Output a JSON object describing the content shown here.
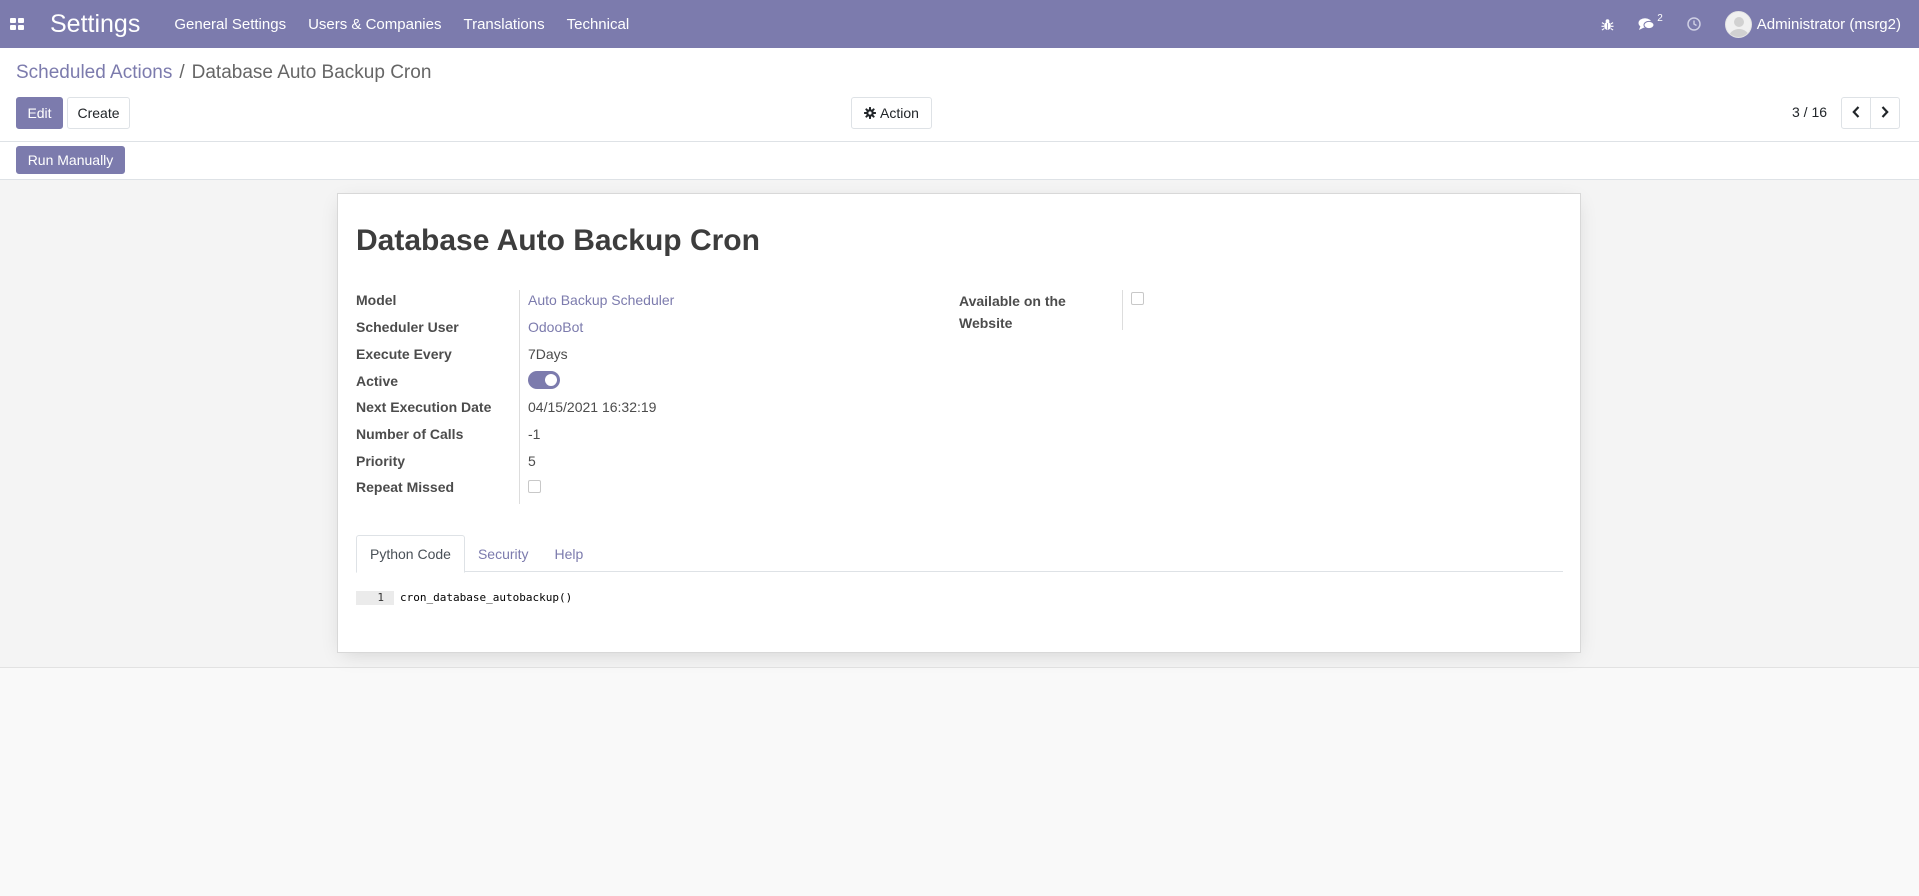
{
  "navbar": {
    "app_title": "Settings",
    "menu": [
      "General Settings",
      "Users & Companies",
      "Translations",
      "Technical"
    ],
    "chat_count": "2",
    "user_name": "Administrator (msrg2)"
  },
  "breadcrumb": {
    "parent": "Scheduled Actions",
    "separator": "/",
    "current": "Database Auto Backup Cron"
  },
  "buttons": {
    "edit": "Edit",
    "create": "Create",
    "action": "Action",
    "run_manually": "Run Manually"
  },
  "pager": {
    "value": "3 / 16"
  },
  "form": {
    "title": "Database Auto Backup Cron",
    "fields": {
      "model_label": "Model",
      "model_value": "Auto Backup Scheduler",
      "user_label": "Scheduler User",
      "user_value": "OdooBot",
      "interval_label": "Execute Every",
      "interval_value": "7Days",
      "active_label": "Active",
      "active_value": true,
      "nextcall_label": "Next Execution Date",
      "nextcall_value": "04/15/2021 16:32:19",
      "numbercall_label": "Number of Calls",
      "numbercall_value": "-1",
      "priority_label": "Priority",
      "priority_value": "5",
      "doall_label": "Repeat Missed",
      "doall_value": false,
      "website_label": "Available on the Website",
      "website_value": false
    },
    "tabs": [
      "Python Code",
      "Security",
      "Help"
    ],
    "active_tab": "Python Code",
    "code": {
      "line_number": "1",
      "line": "cron_database_autobackup()"
    }
  },
  "colors": {
    "brand": "#7c7bad",
    "background": "#f9f9f9"
  }
}
